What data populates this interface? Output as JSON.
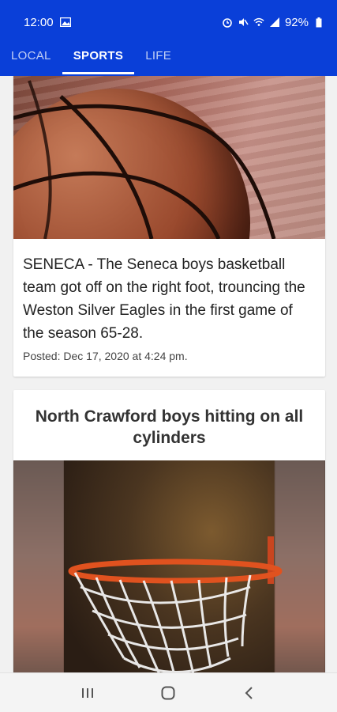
{
  "status_bar": {
    "time": "12:00",
    "battery": "92%"
  },
  "tabs": [
    {
      "label": "LOCAL",
      "active": false
    },
    {
      "label": "SPORTS",
      "active": true
    },
    {
      "label": "LIFE",
      "active": false
    }
  ],
  "articles": [
    {
      "image": "basketball-closeup",
      "summary": "SENECA - The Seneca boys basketball team got off on the right foot, trouncing the Weston Silver Eagles in the first game of the season 65-28.",
      "posted": "Posted: Dec 17, 2020 at 4:24 pm."
    },
    {
      "title": "North Crawford boys hitting on all cylinders",
      "image": "basketball-hoop-net"
    }
  ],
  "nav_buttons": [
    "recent-apps",
    "home",
    "back"
  ],
  "colors": {
    "app_bar": "#0a3fd8",
    "background": "#f1f1f1"
  }
}
